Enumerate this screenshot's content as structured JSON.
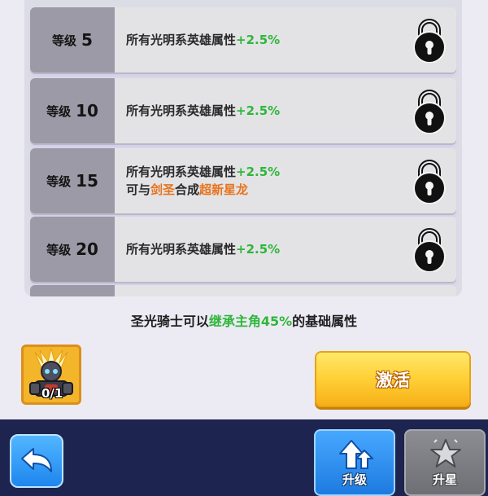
{
  "colors": {
    "bonus_green": "#2fb63a",
    "highlight_orange": "#e8731c",
    "activate_yellow": "#ffd23a",
    "bottom_bar_navy": "#1d2450",
    "upgrade_blue": "#1d7be0",
    "disabled_gray": "#7c7d82"
  },
  "levels": [
    {
      "prefix": "等级",
      "level": "5",
      "text": "所有光明系英雄属性",
      "bonus": "+2.5%",
      "icon": "lock-icon"
    },
    {
      "prefix": "等级",
      "level": "10",
      "text": "所有光明系英雄属性",
      "bonus": "+2.5%",
      "icon": "lock-icon"
    },
    {
      "prefix": "等级",
      "level": "15",
      "text": "所有光明系英雄属性",
      "bonus": "+2.5%",
      "line2": {
        "a": "可与",
        "b": "剑圣",
        "c": "合成",
        "d": "超新星龙"
      },
      "icon": "lock-icon"
    },
    {
      "prefix": "等级",
      "level": "20",
      "text": "所有光明系英雄属性",
      "bonus": "+2.5%",
      "icon": "lock-icon"
    }
  ],
  "inherit": {
    "part1": "圣光骑士可以",
    "part2": "继承主角45%",
    "part3": "的基础属性"
  },
  "hero_card": {
    "count": "0/1",
    "icon": "light-knight-portrait"
  },
  "activate_label": "激活",
  "back_icon": "back-arrow-icon",
  "upgrade": {
    "label": "升级",
    "icon": "upgrade-arrows-icon"
  },
  "star_up": {
    "label": "升星",
    "icon": "star-icon",
    "enabled": false
  }
}
